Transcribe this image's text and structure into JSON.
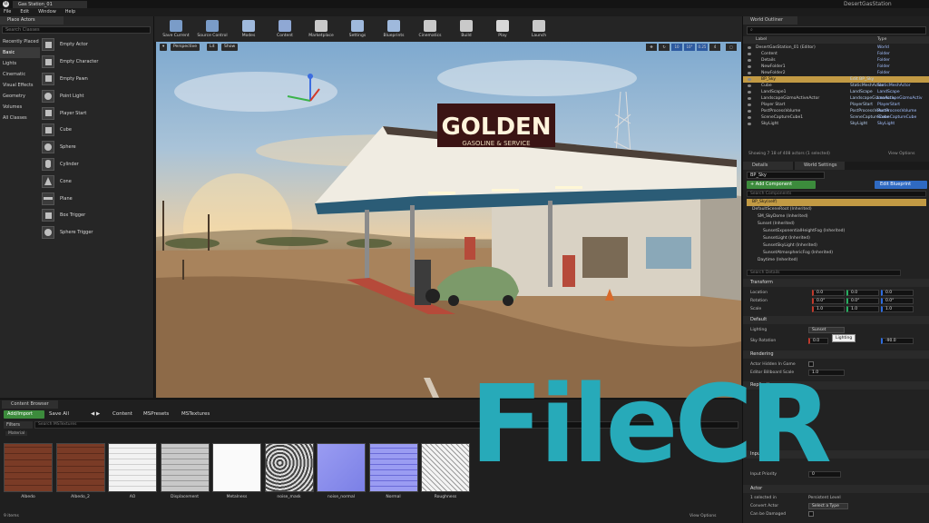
{
  "window": {
    "tab_title": "Gas Station_01",
    "project_name": "DesertGasStation"
  },
  "menu": [
    "File",
    "Edit",
    "Window",
    "Help"
  ],
  "place_actors": {
    "tab": "Place Actors",
    "search_placeholder": "Search Classes",
    "categories": [
      "Recently Placed",
      "Basic",
      "Lights",
      "Cinematic",
      "Visual Effects",
      "Geometry",
      "Volumes",
      "All Classes"
    ],
    "active_category": "Basic",
    "items": [
      "Empty Actor",
      "Empty Character",
      "Empty Pawn",
      "Point Light",
      "Player Start",
      "Cube",
      "Sphere",
      "Cylinder",
      "Cone",
      "Plane",
      "Box Trigger",
      "Sphere Trigger"
    ]
  },
  "toolbar": [
    {
      "label": "Save Current",
      "icon": "save-icon",
      "color": "#7a9cc8"
    },
    {
      "label": "Source Control",
      "icon": "source-control-icon",
      "color": "#7a9cc8"
    },
    {
      "label": "Modes",
      "icon": "modes-icon",
      "color": "#9fb9dc"
    },
    {
      "label": "Content",
      "icon": "content-icon",
      "color": "#8fa8d4"
    },
    {
      "label": "Marketplace",
      "icon": "marketplace-icon",
      "color": "#c9c9c9"
    },
    {
      "label": "Settings",
      "icon": "settings-icon",
      "color": "#9fb9dc"
    },
    {
      "label": "Blueprints",
      "icon": "blueprints-icon",
      "color": "#9fb9dc"
    },
    {
      "label": "Cinematics",
      "icon": "cinematics-icon",
      "color": "#c9c9c9"
    },
    {
      "label": "Build",
      "icon": "build-icon",
      "color": "#c9c9c9"
    },
    {
      "label": "Play",
      "icon": "play-icon",
      "color": "#d8d8d8"
    },
    {
      "label": "Launch",
      "icon": "launch-icon",
      "color": "#c9c9c9"
    }
  ],
  "viewport": {
    "perspective": "Perspective",
    "lit": "Lit",
    "show": "Show",
    "snap_values": [
      "10",
      "10°",
      "0.25",
      "4"
    ],
    "sign_text": "GOLDEN",
    "sign_subtext": "GASOLINE & SERVICE"
  },
  "outliner": {
    "tab": "World Outliner",
    "search_value": "",
    "col_label": "Label",
    "col_type": "Type",
    "rows": [
      {
        "name": "DesertGasStation_01 (Editor)",
        "type": "World",
        "indent": 0
      },
      {
        "name": "Content",
        "type": "Folder",
        "indent": 1
      },
      {
        "name": "Details",
        "type": "Folder",
        "indent": 1
      },
      {
        "name": "NewFolder1",
        "type": "Folder",
        "indent": 1
      },
      {
        "name": "NewFolder2",
        "type": "Folder",
        "indent": 1
      },
      {
        "name": "BP_Sky",
        "mid": "Edit BP_Sky",
        "type": "",
        "indent": 1,
        "selected": true
      },
      {
        "name": "Cube",
        "mid": "StaticMeshActor",
        "type": "StaticMeshActor",
        "indent": 1
      },
      {
        "name": "LandScape1",
        "mid": "LandScape",
        "type": "LandScape",
        "indent": 1
      },
      {
        "name": "LandscapeGizmoActiveActor",
        "mid": "LandscapeGizmoActiv",
        "type": "LandscapeGizmoActiv",
        "indent": 1
      },
      {
        "name": "Player Start",
        "mid": "PlayerStart",
        "type": "PlayerStart",
        "indent": 1
      },
      {
        "name": "PostProcessVolume",
        "mid": "PostProcessVolume",
        "type": "PostProcessVolume",
        "indent": 1
      },
      {
        "name": "SceneCaptureCube1",
        "mid": "SceneCaptureCube",
        "type": "SceneCaptureCube",
        "indent": 1
      },
      {
        "name": "SkyLight",
        "mid": "SkyLight",
        "type": "SkyLight",
        "indent": 1
      }
    ],
    "footer_count": "Showing 7 18 of 408 actors (1 selected)",
    "view_options": "View Options"
  },
  "details": {
    "tabs": [
      "Details",
      "World Settings"
    ],
    "name_value": "BP_Sky",
    "add_component": "+ Add Component",
    "edit_blueprint": "Edit Blueprint",
    "component_search": "Search Components",
    "components": [
      "BP_Sky(self)",
      "DefaultSceneRoot (Inherited)",
      "SM_SkyDome (Inherited)",
      "Sunset (Inherited)",
      "SunsetExponentialHeightFog (Inherited)",
      "SunsetLight (Inherited)",
      "SunsetSkyLight (Inherited)",
      "SunsetAtmosphericFog (Inherited)",
      "Daytime (Inherited)"
    ],
    "details_search": "Search Details",
    "transform_label": "Transform",
    "location_label": "Location",
    "rotation_label": "Rotation",
    "scale_label": "Scale",
    "location": [
      "0.0",
      "0.0",
      "0.0"
    ],
    "rotation": [
      "0.0°",
      "0.0°",
      "0.0°"
    ],
    "scale": [
      "1.0",
      "1.0",
      "1.0"
    ],
    "default_label": "Default",
    "lighting_label": "Lighting",
    "lighting_value": "Sunset",
    "tooltip": "Lighting",
    "sky_rotation_label": "Sky Rotation",
    "sky_rotation": [
      "0.0",
      "0.0",
      "-90.0"
    ],
    "rendering_label": "Rendering",
    "actor_hidden_label": "Actor Hidden In Game",
    "billboard_label": "Editor Billboard Scale",
    "billboard_value": "1.0",
    "replication_label": "Replication",
    "input_label": "Input",
    "actor_label": "Actor",
    "input_priority_label": "Input Priority",
    "input_priority_value": "0",
    "selected_in_label": "1 selected in",
    "persistent_level": "Persistent Level",
    "convert_actor_label": "Convert Actor",
    "convert_actor_value": "Select a Type",
    "can_be_damaged_label": "Can be Damaged"
  },
  "content_browser": {
    "tab": "Content Browser",
    "add_import": "Add/Import",
    "save_all": "Save All",
    "breadcrumbs": [
      "Content",
      "MSPresets",
      "MSTextures"
    ],
    "filters": "Filters",
    "search_placeholder": "Search MSTextures",
    "filter_chip": "Material",
    "assets": [
      {
        "name": "Albedo",
        "fill": "brick"
      },
      {
        "name": "Albedo_2",
        "fill": "brick"
      },
      {
        "name": "AO",
        "fill": "white-lines"
      },
      {
        "name": "Displacement",
        "fill": "grey-lines"
      },
      {
        "name": "Metalness",
        "fill": "white"
      },
      {
        "name": "noise_mask",
        "fill": "noise"
      },
      {
        "name": "noise_normal",
        "fill": "normal"
      },
      {
        "name": "Normal",
        "fill": "normal-lines"
      },
      {
        "name": "Roughness",
        "fill": "rough"
      }
    ],
    "item_count": "9 items",
    "view_options": "View Options"
  },
  "watermark": "FileCR"
}
